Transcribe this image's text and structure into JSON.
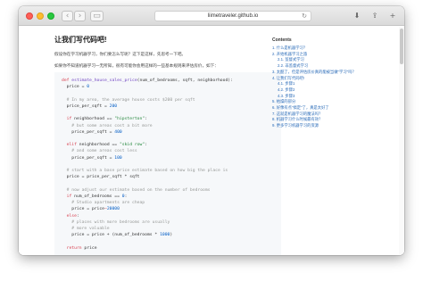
{
  "browser": {
    "url": "liimetraveler.github.io",
    "back_icon": "‹",
    "forward_icon": "›",
    "sidebar_icon": "▭",
    "reload_icon": "↻",
    "download_icon": "⬇",
    "share_icon": "⇪",
    "new_tab_icon": "+"
  },
  "article": {
    "title": "让我们写代码吧!",
    "intro": "假设你在学习机器学习，你们要怎么写呢？这下是这样，先思考一下吧。",
    "para": "如果你不知道机器学习一无所知，很有可能你会用这样的一些基本规则来评估房价，如下："
  },
  "code": {
    "lines": [
      [
        {
          "t": "def ",
          "c": "kw"
        },
        {
          "t": "estimate_house_sales_price",
          "c": "fn"
        },
        {
          "t": "(num_of_bedrooms, sqft, neighborhood):",
          "c": ""
        }
      ],
      [
        {
          "t": "  price = ",
          "c": ""
        },
        {
          "t": "0",
          "c": "num"
        }
      ],
      [
        {
          "t": "",
          "c": ""
        }
      ],
      [
        {
          "t": "  # In my area, the average house costs $200 per sqft",
          "c": "cm"
        }
      ],
      [
        {
          "t": "  price_per_sqft = ",
          "c": ""
        },
        {
          "t": "200",
          "c": "num"
        }
      ],
      [
        {
          "t": "",
          "c": ""
        }
      ],
      [
        {
          "t": "  ",
          "c": ""
        },
        {
          "t": "if ",
          "c": "kw"
        },
        {
          "t": "neighborhood == ",
          "c": ""
        },
        {
          "t": "\"hipsterton\"",
          "c": "str"
        },
        {
          "t": ":",
          "c": ""
        }
      ],
      [
        {
          "t": "    # but some areas cost a bit more",
          "c": "cm"
        }
      ],
      [
        {
          "t": "    price_per_sqft = ",
          "c": ""
        },
        {
          "t": "400",
          "c": "num"
        }
      ],
      [
        {
          "t": "",
          "c": ""
        }
      ],
      [
        {
          "t": "  ",
          "c": ""
        },
        {
          "t": "elif ",
          "c": "kw"
        },
        {
          "t": "neighborhood == ",
          "c": ""
        },
        {
          "t": "\"skid row\"",
          "c": "str"
        },
        {
          "t": ":",
          "c": ""
        }
      ],
      [
        {
          "t": "    # and some areas cost less",
          "c": "cm"
        }
      ],
      [
        {
          "t": "    price_per_sqft = ",
          "c": ""
        },
        {
          "t": "100",
          "c": "num"
        }
      ],
      [
        {
          "t": "",
          "c": ""
        }
      ],
      [
        {
          "t": "  # start with a base price estimate based on how big the place is",
          "c": "cm"
        }
      ],
      [
        {
          "t": "  price = price_per_sqft * sqft",
          "c": ""
        }
      ],
      [
        {
          "t": "",
          "c": ""
        }
      ],
      [
        {
          "t": "  # now adjust our estimate based on the number of bedrooms",
          "c": "cm"
        }
      ],
      [
        {
          "t": "  ",
          "c": ""
        },
        {
          "t": "if ",
          "c": "kw"
        },
        {
          "t": "num_of_bedrooms == ",
          "c": ""
        },
        {
          "t": "0",
          "c": "num"
        },
        {
          "t": ":",
          "c": ""
        }
      ],
      [
        {
          "t": "    # Studio apartments are cheap",
          "c": "cm"
        }
      ],
      [
        {
          "t": "    price = price",
          "c": ""
        },
        {
          "t": "—",
          "c": "kw"
        },
        {
          "t": "20000",
          "c": "num"
        }
      ],
      [
        {
          "t": "  ",
          "c": ""
        },
        {
          "t": "else",
          "c": "kw"
        },
        {
          "t": ":",
          "c": ""
        }
      ],
      [
        {
          "t": "    # places with more bedrooms are usually",
          "c": "cm"
        }
      ],
      [
        {
          "t": "    # more valuable",
          "c": "cm"
        }
      ],
      [
        {
          "t": "    price = price + (num_of_bedrooms * ",
          "c": ""
        },
        {
          "t": "1000",
          "c": "num"
        },
        {
          "t": ")",
          "c": ""
        }
      ],
      [
        {
          "t": "",
          "c": ""
        }
      ],
      [
        {
          "t": "  ",
          "c": ""
        },
        {
          "t": "return ",
          "c": "kw"
        },
        {
          "t": "price",
          "c": ""
        }
      ]
    ]
  },
  "toc": {
    "title": "Contents",
    "items": [
      {
        "label": "1. 什么是机器学习？",
        "sub": false
      },
      {
        "label": "2. 开始机器学习之旅",
        "sub": false
      },
      {
        "label": "2.1. 监督式学习",
        "sub": true
      },
      {
        "label": "2.2. 非监督式学习",
        "sub": true
      },
      {
        "label": "3. 太酷了，但是评估房价真的能被当做\"学习\"吗？",
        "sub": false
      },
      {
        "label": "4. 让我们写代码吧!",
        "sub": false
      },
      {
        "label": "4.1. 步骤1",
        "sub": true
      },
      {
        "label": "4.2. 步骤2",
        "sub": true
      },
      {
        "label": "4.3. 步骤3",
        "sub": true
      },
      {
        "label": "5. 枯燥的部分",
        "sub": false
      },
      {
        "label": "6. 好像有点\"搞定\"了，真是太好了",
        "sub": false
      },
      {
        "label": "7. 这就是机器学习的魔法吗？",
        "sub": false
      },
      {
        "label": "8. 机器学习什么时候最有效？",
        "sub": false
      },
      {
        "label": "9. 更多学习机器学习的资源",
        "sub": false
      }
    ]
  }
}
